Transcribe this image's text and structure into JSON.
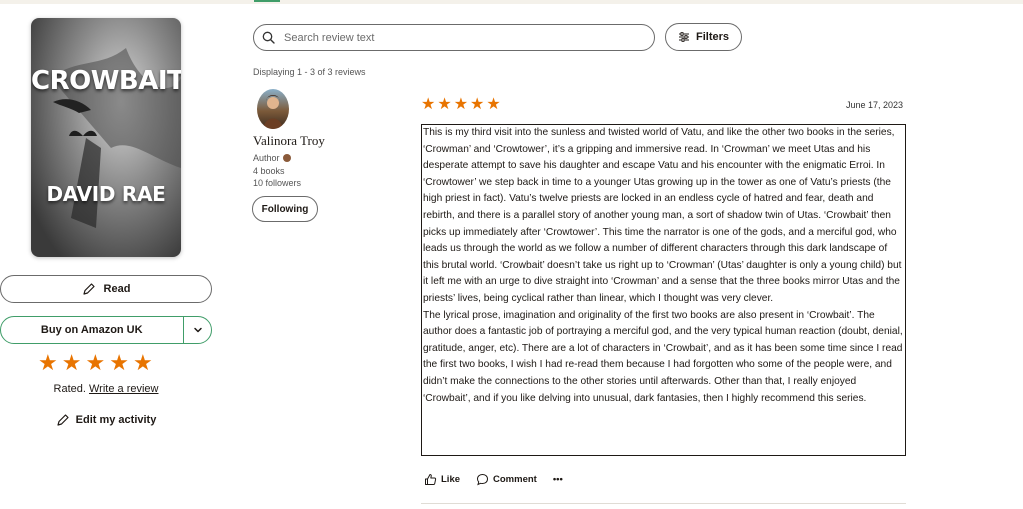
{
  "book": {
    "cover_title": "CROWBAIT",
    "cover_author": "DAVID RAE"
  },
  "actions": {
    "read_label": "Read",
    "buy_label": "Buy on Amazon UK",
    "edit_activity_label": "Edit my activity"
  },
  "user_rating": {
    "stars": 5,
    "rated_prefix": "Rated.",
    "write_review_label": "Write a review"
  },
  "search": {
    "placeholder": "Search review text",
    "filters_label": "Filters"
  },
  "reviews_summary": "Displaying 1 - 3 of 3 reviews",
  "reviewer": {
    "name": "Valinora Troy",
    "role": "Author",
    "books": "4 books",
    "followers": "10 followers",
    "follow_label": "Following"
  },
  "review": {
    "stars": 5,
    "date": "June 17, 2023",
    "paragraph1": "This is my third visit into the sunless and twisted world of Vatu, and like the other two books in the series, ‘Crowman’ and ‘Crowtower’, it’s a gripping and immersive read. In ‘Crowman’ we meet Utas and his desperate attempt to save his daughter and escape Vatu and his encounter with the enigmatic Erroi. In ‘Crowtower’ we step back in time to a younger Utas growing up in the tower as one of Vatu’s priests (the high priest in fact). Vatu’s twelve priests are locked in an endless cycle of hatred and fear, death and rebirth, and there is a parallel story of another young man, a sort of shadow twin of Utas. ‘Crowbait’ then picks up immediately after ‘Crowtower’. This time the narrator is one of the gods, and a merciful god, who leads us through the world as we follow a number of different characters through this dark landscape of this brutal world. ‘Crowbait’ doesn’t take us right up to ‘Crowman’ (Utas’ daughter is only a young child) but it left me with an urge to dive straight into ‘Crowman’ and a sense that the three books mirror Utas and the priests’ lives, being cyclical rather than linear, which I thought was very clever.",
    "paragraph2": "The lyrical prose, imagination and originality of the first two books are also present in ‘Crowbait’. The author does a fantastic job of portraying a merciful god, and the very typical human reaction (doubt, denial, gratitude, anger, etc). There are a lot of characters in ‘Crowbait’, and as it has been some time since I read the first two books, I wish I had re-read them because I had forgotten who some of the people were, and didn’t make the connections to the other stories until afterwards. Other than that, I really enjoyed ‘Crowbait’, and if you like delving into unusual, dark fantasies, then I highly recommend this series.",
    "like_label": "Like",
    "comment_label": "Comment",
    "more_label": "•••"
  },
  "colors": {
    "star": "#e87400",
    "buy_border": "#409d69"
  }
}
